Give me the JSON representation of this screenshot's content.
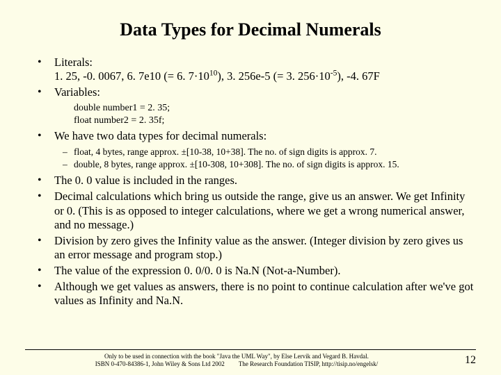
{
  "title": "Data Types for Decimal Numerals",
  "b1_label": "Literals:",
  "b1_line2a": "1. 25, -0. 0067, 6. 7e10 (= 6. 7·10",
  "b1_sup1": "10",
  "b1_line2b": "), 3. 256e-5 (= 3. 256·10",
  "b1_sup2": "-5",
  "b1_line2c": "), -4. 67F",
  "b2": "Variables:",
  "code1": "double number1 = 2. 35;",
  "code2": "float number2 = 2. 35f;",
  "b3": "We have two data types for decimal numerals:",
  "s1": "float, 4 bytes, range approx. ±[10-38, 10+38]. The no. of sign digits is approx. 7.",
  "s2": "double, 8 bytes, range approx. ±[10-308, 10+308]. The no. of sign digits is approx. 15.",
  "b4": "The 0. 0 value is included in the ranges.",
  "b5": "Decimal calculations which bring us outside the range, give us an answer. We get Infinity or 0. (This is as opposed to integer calculations, where we get a wrong numerical answer, and no message.)",
  "b6": "Division by zero gives the Infinity value as the answer. (Integer division by zero gives us an error message and program stop.)",
  "b7": "The value of the expression 0. 0/0. 0 is Na.N (Not-a-Number).",
  "b8": "Although we get values as answers, there is no point to continue calculation after we've got values as Infinity and Na.N.",
  "footer1": "Only to be used in connection with the book \"Java the UML Way\", by Else Lervik and Vegard B. Havdal.",
  "footer2": "ISBN 0-470-84386-1, John Wiley & Sons Ltd 2002",
  "footer3": "The Research Foundation TISIP, http://tisip.no/engelsk/",
  "page": "12"
}
